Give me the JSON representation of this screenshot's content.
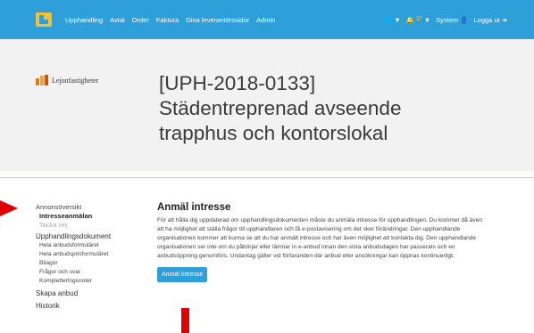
{
  "nav": {
    "links": [
      "Upphandling",
      "Avtal",
      "Order",
      "Faktura",
      "Dina leverantörssidor",
      "Admin"
    ],
    "notifications_count": "37",
    "system_label": "System",
    "logout_label": "Logga ut"
  },
  "org": {
    "name": "Lejonfastigheter"
  },
  "title": {
    "lines": [
      "[UPH-2018-0133]",
      "Städentreprenad avseende",
      "trapphus och kontorslokal"
    ]
  },
  "sidebar": {
    "overview": "Annonsöversikt",
    "register": "Intresseanmälan",
    "decline": "Tacka nej",
    "docs": "Upphandlingsdokument",
    "doc_items": [
      "Hela anbudsformuläret",
      "Hela anbudsprisformuläret",
      "Bilagor",
      "Frågor och svar",
      "Kompletteringsnoter"
    ],
    "create_bid": "Skapa anbud",
    "history": "Historik"
  },
  "main": {
    "heading": "Anmäl intresse",
    "body": "För att hålla dig uppdaterad om upphandlingsdokumenten måste du anmäla intresse för upphandlingen. Du kommer då även att ha möjlighet att ställa frågor till upphandlaren och få e-postavisering om det sker förändringar. Den upphandlande organisationen kommer att kunna se att du har anmält intresse och har även möjlighet att kontakta dig. Den upphandlande organisationen ser inte om du påbörjar eller lämnar in e-anbud innan den sista anbudsdagen har passerats och en anbudsöppning genomförs. Undantag gäller vid förfaranden där anbud eller ansökningar kan öppnas kontinuerligt.",
    "button": "Anmäl intresse"
  },
  "colors": {
    "brand": "#2e9fd9",
    "annotation": "#e00000"
  }
}
